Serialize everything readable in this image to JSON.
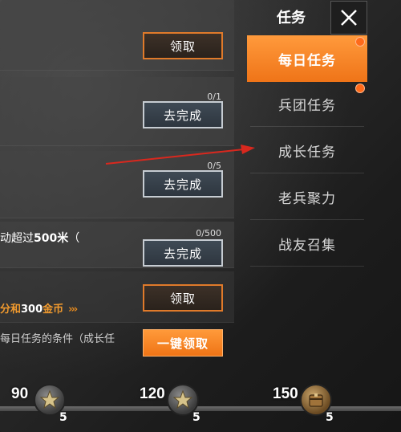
{
  "menu": {
    "title": "任务",
    "items": [
      {
        "label": "每日任务",
        "active": true,
        "badge": true
      },
      {
        "label": "兵团任务",
        "active": false,
        "badge": true
      },
      {
        "label": "成长任务",
        "active": false,
        "badge": false
      },
      {
        "label": "老兵聚力",
        "active": false,
        "badge": false
      },
      {
        "label": "战友召集",
        "active": false,
        "badge": false
      }
    ]
  },
  "tasks": [
    {
      "button": "领取"
    },
    {
      "progress": "0/1",
      "button": "去完成"
    },
    {
      "progress": "0/5",
      "button": "去完成"
    },
    {
      "text_pre": "动超过",
      "text_bold": "500米",
      "text_post": "（",
      "progress": "0/500",
      "button": "去完成"
    },
    {
      "reward_pre": "分和",
      "reward_amount": "300",
      "reward_post": "金币",
      "button": "领取"
    }
  ],
  "footer": {
    "hint": "每日任务的条件（成长任",
    "one_key_button": "一键领取"
  },
  "milestones": [
    {
      "value": "90",
      "count": "5",
      "icon": "star-badge-icon"
    },
    {
      "value": "120",
      "count": "5",
      "icon": "star-badge-icon"
    },
    {
      "value": "150",
      "count": "5",
      "icon": "crate-badge-icon"
    }
  ],
  "colors": {
    "accent": "#ef7418",
    "arrow": "#d9281e"
  }
}
